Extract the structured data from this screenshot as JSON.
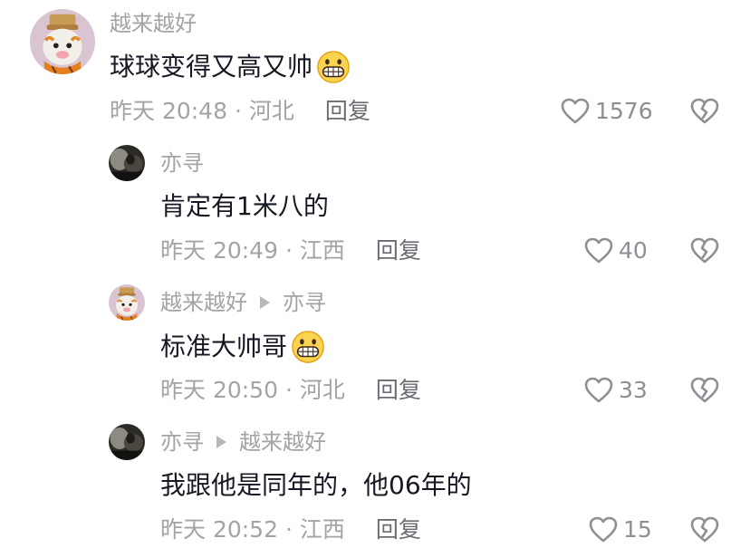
{
  "comments": [
    {
      "username": "越来越好",
      "text": "球球变得又高又帅",
      "emoji": "grinning-face-emoji",
      "time_location": "昨天 20:48 · 河北",
      "reply_label": "回复",
      "likes": "1576"
    },
    {
      "username": "亦寻",
      "text": "肯定有1米八的",
      "time_location": "昨天 20:49 · 江西",
      "reply_label": "回复",
      "likes": "40"
    },
    {
      "username": "越来越好",
      "reply_to": "亦寻",
      "text": "标准大帅哥",
      "emoji": "grinning-face-emoji",
      "time_location": "昨天 20:50 · 河北",
      "reply_label": "回复",
      "likes": "33"
    },
    {
      "username": "亦寻",
      "reply_to": "越来越好",
      "text": "我跟他是同年的，他06年的",
      "time_location": "昨天 20:52 · 江西",
      "reply_label": "回复",
      "likes": "15"
    }
  ],
  "icons": {
    "like": "heart-outline-icon",
    "dislike": "broken-heart-icon",
    "reply_to": "triangle-right-icon"
  },
  "colors": {
    "username": "#a3a3a8",
    "text": "#161823",
    "meta": "#a3a3a8",
    "reply": "#6b6b73",
    "icon": "#8e8e94"
  }
}
